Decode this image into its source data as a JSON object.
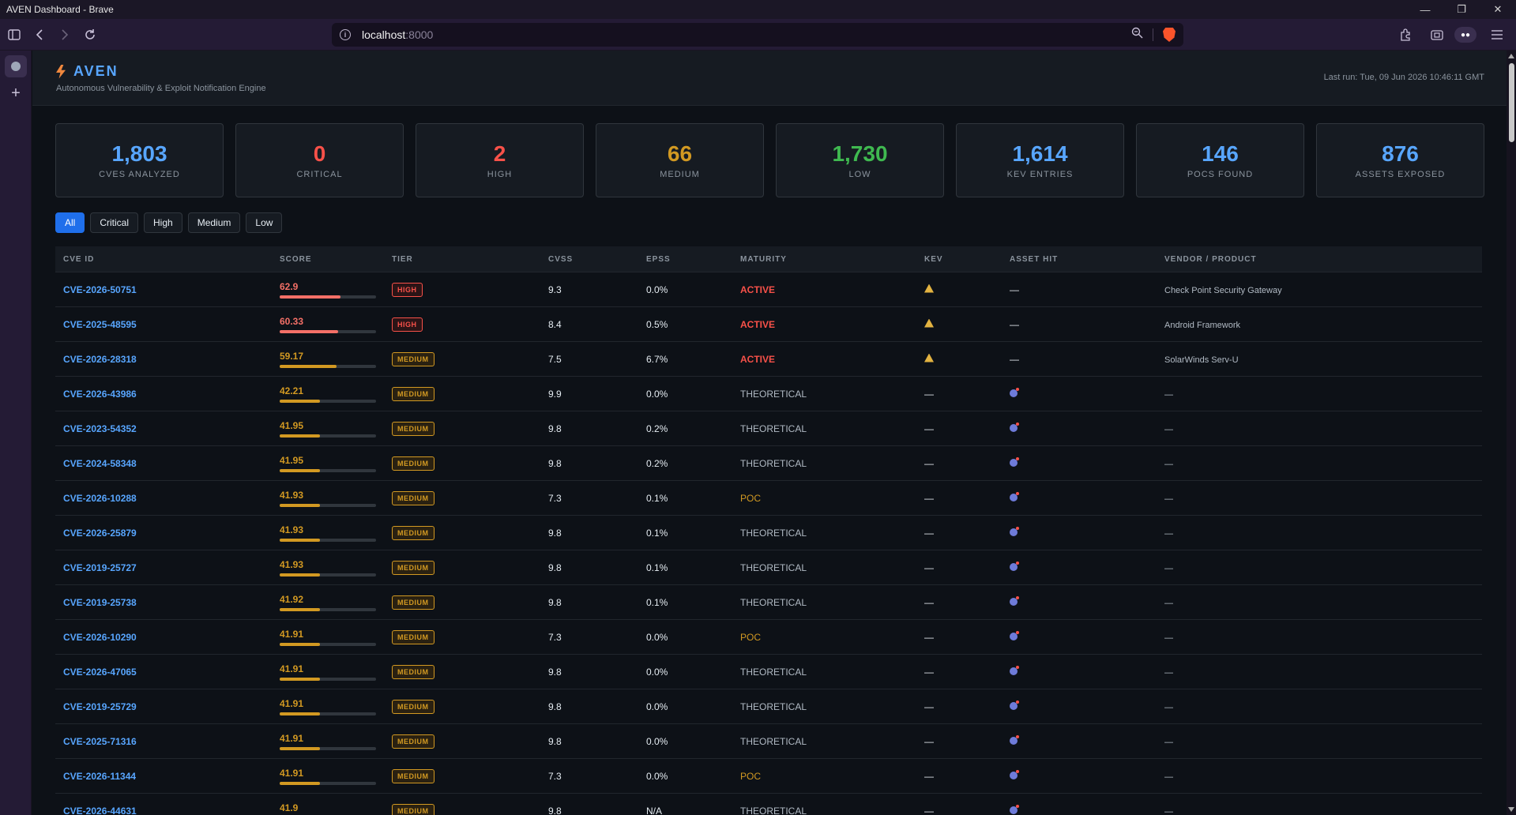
{
  "browser": {
    "window_title": "AVEN Dashboard - Brave",
    "url_host": "localhost",
    "url_port": ":8000"
  },
  "app": {
    "name": "AVEN",
    "tagline": "Autonomous Vulnerability & Exploit Notification Engine",
    "last_run": "Last run: Tue, 09 Jun 2026 10:46:11 GMT"
  },
  "stats": [
    {
      "value": "1,803",
      "label": "CVEs Analyzed",
      "color": "#58a6ff"
    },
    {
      "value": "0",
      "label": "Critical",
      "color": "#f85149"
    },
    {
      "value": "2",
      "label": "High",
      "color": "#f85149"
    },
    {
      "value": "66",
      "label": "Medium",
      "color": "#d29922"
    },
    {
      "value": "1,730",
      "label": "Low",
      "color": "#3fb950"
    },
    {
      "value": "1,614",
      "label": "KEV Entries",
      "color": "#58a6ff"
    },
    {
      "value": "146",
      "label": "POCs Found",
      "color": "#58a6ff"
    },
    {
      "value": "876",
      "label": "Assets Exposed",
      "color": "#58a6ff"
    }
  ],
  "filters": [
    "All",
    "Critical",
    "High",
    "Medium",
    "Low"
  ],
  "active_filter": "All",
  "table": {
    "columns": [
      "CVE ID",
      "Score",
      "Tier",
      "CVSS",
      "EPSS",
      "Maturity",
      "KEV",
      "Asset Hit",
      "Vendor / Product"
    ],
    "rows": [
      {
        "id": "CVE-2026-50751",
        "score": "62.9",
        "score_pct": 62.9,
        "tier": "HIGH",
        "cvss": "9.3",
        "epss": "0.0%",
        "maturity": "ACTIVE",
        "kev": true,
        "asset": false,
        "vendor": "Check Point Security Gateway"
      },
      {
        "id": "CVE-2025-48595",
        "score": "60.33",
        "score_pct": 60.33,
        "tier": "HIGH",
        "cvss": "8.4",
        "epss": "0.5%",
        "maturity": "ACTIVE",
        "kev": true,
        "asset": false,
        "vendor": "Android Framework"
      },
      {
        "id": "CVE-2026-28318",
        "score": "59.17",
        "score_pct": 59.17,
        "tier": "MEDIUM",
        "cvss": "7.5",
        "epss": "6.7%",
        "maturity": "ACTIVE",
        "kev": true,
        "asset": false,
        "vendor": "SolarWinds Serv-U"
      },
      {
        "id": "CVE-2026-43986",
        "score": "42.21",
        "score_pct": 42.21,
        "tier": "MEDIUM",
        "cvss": "9.9",
        "epss": "0.0%",
        "maturity": "THEORETICAL",
        "kev": false,
        "asset": true,
        "vendor": "—"
      },
      {
        "id": "CVE-2023-54352",
        "score": "41.95",
        "score_pct": 41.95,
        "tier": "MEDIUM",
        "cvss": "9.8",
        "epss": "0.2%",
        "maturity": "THEORETICAL",
        "kev": false,
        "asset": true,
        "vendor": "—"
      },
      {
        "id": "CVE-2024-58348",
        "score": "41.95",
        "score_pct": 41.95,
        "tier": "MEDIUM",
        "cvss": "9.8",
        "epss": "0.2%",
        "maturity": "THEORETICAL",
        "kev": false,
        "asset": true,
        "vendor": "—"
      },
      {
        "id": "CVE-2026-10288",
        "score": "41.93",
        "score_pct": 41.93,
        "tier": "MEDIUM",
        "cvss": "7.3",
        "epss": "0.1%",
        "maturity": "POC",
        "kev": false,
        "asset": true,
        "vendor": "—"
      },
      {
        "id": "CVE-2026-25879",
        "score": "41.93",
        "score_pct": 41.93,
        "tier": "MEDIUM",
        "cvss": "9.8",
        "epss": "0.1%",
        "maturity": "THEORETICAL",
        "kev": false,
        "asset": true,
        "vendor": "—"
      },
      {
        "id": "CVE-2019-25727",
        "score": "41.93",
        "score_pct": 41.93,
        "tier": "MEDIUM",
        "cvss": "9.8",
        "epss": "0.1%",
        "maturity": "THEORETICAL",
        "kev": false,
        "asset": true,
        "vendor": "—"
      },
      {
        "id": "CVE-2019-25738",
        "score": "41.92",
        "score_pct": 41.92,
        "tier": "MEDIUM",
        "cvss": "9.8",
        "epss": "0.1%",
        "maturity": "THEORETICAL",
        "kev": false,
        "asset": true,
        "vendor": "—"
      },
      {
        "id": "CVE-2026-10290",
        "score": "41.91",
        "score_pct": 41.91,
        "tier": "MEDIUM",
        "cvss": "7.3",
        "epss": "0.0%",
        "maturity": "POC",
        "kev": false,
        "asset": true,
        "vendor": "—"
      },
      {
        "id": "CVE-2026-47065",
        "score": "41.91",
        "score_pct": 41.91,
        "tier": "MEDIUM",
        "cvss": "9.8",
        "epss": "0.0%",
        "maturity": "THEORETICAL",
        "kev": false,
        "asset": true,
        "vendor": "—"
      },
      {
        "id": "CVE-2019-25729",
        "score": "41.91",
        "score_pct": 41.91,
        "tier": "MEDIUM",
        "cvss": "9.8",
        "epss": "0.0%",
        "maturity": "THEORETICAL",
        "kev": false,
        "asset": true,
        "vendor": "—"
      },
      {
        "id": "CVE-2025-71316",
        "score": "41.91",
        "score_pct": 41.91,
        "tier": "MEDIUM",
        "cvss": "9.8",
        "epss": "0.0%",
        "maturity": "THEORETICAL",
        "kev": false,
        "asset": true,
        "vendor": "—"
      },
      {
        "id": "CVE-2026-11344",
        "score": "41.91",
        "score_pct": 41.91,
        "tier": "MEDIUM",
        "cvss": "7.3",
        "epss": "0.0%",
        "maturity": "POC",
        "kev": false,
        "asset": true,
        "vendor": "—"
      },
      {
        "id": "CVE-2026-44631",
        "score": "41.9",
        "score_pct": 41.9,
        "tier": "MEDIUM",
        "cvss": "9.8",
        "epss": "N/A",
        "maturity": "THEORETICAL",
        "kev": false,
        "asset": true,
        "vendor": "—"
      }
    ]
  },
  "empty_value": "—",
  "colors": {
    "accent": "#58a6ff",
    "high": "#f85149",
    "high_bar": "#f47067",
    "medium": "#d29922",
    "low": "#3fb950"
  }
}
